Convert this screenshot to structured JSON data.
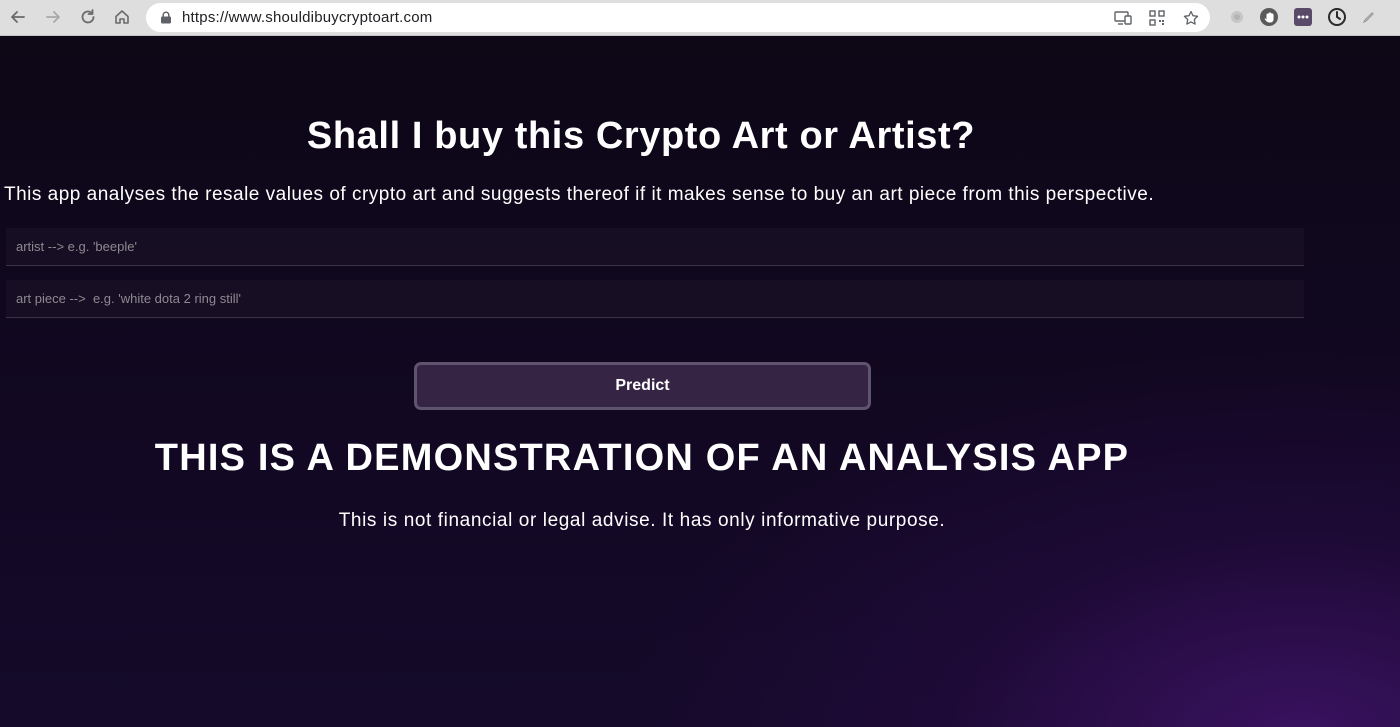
{
  "browser": {
    "url": "https://www.shouldibuycryptoart.com",
    "icons": {
      "back": "back-arrow-icon",
      "forward": "forward-arrow-icon",
      "reload": "reload-icon",
      "home": "home-icon",
      "lock": "lock-icon",
      "cast": "cast-icon",
      "qr": "qr-code-icon",
      "bookmark": "star-icon"
    }
  },
  "page": {
    "title": "Shall I buy this Crypto Art or Artist?",
    "description": "This app analyses the resale values of crypto art and suggests thereof if it makes sense to buy an art piece from this perspective.",
    "artist_input": {
      "placeholder": "artist --> e.g. 'beeple'",
      "value": ""
    },
    "piece_input": {
      "placeholder": "art piece -->  e.g. 'white dota 2 ring still'",
      "value": ""
    },
    "predict_label": "Predict",
    "demo_heading": "THIS IS A DEMONSTRATION OF AN ANALYSIS APP",
    "disclaimer": "This is not financial or legal advise. It has only informative purpose."
  },
  "colors": {
    "background": "#0e0718",
    "accent_glow": "#3a1260",
    "button_bg": "#362445",
    "button_border": "#5f5470",
    "text": "#ffffff"
  }
}
